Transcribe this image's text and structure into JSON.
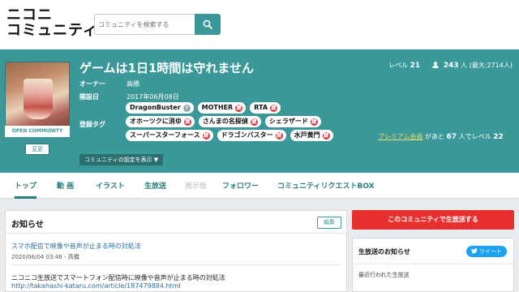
{
  "header": {
    "logo_line1": "ニコニ",
    "logo_line2": "コミュニティ",
    "search_placeholder": "コミュニティを検索する"
  },
  "community": {
    "title": "ゲームは1日1時間は守れません",
    "thumb_label": "OPEN COMMUNITY",
    "change_label": "変更",
    "level_label": "レベル",
    "level": "21",
    "members": "243",
    "members_unit": "人",
    "members_max": "(最大:2714人)",
    "owner_label": "オーナー",
    "owner": "高橋",
    "opened_label": "開設日",
    "opened": "2017年06月08日",
    "tags_label": "登録タグ",
    "tags": [
      {
        "name": "DragonBuster",
        "lock": "?",
        "locked": false
      },
      {
        "name": "MOTHER",
        "lock": "鍵",
        "locked": true
      },
      {
        "name": "RTA",
        "lock": "鍵",
        "locked": true
      },
      {
        "name": "オホーツクに消ゆ",
        "lock": "鍵",
        "locked": true
      },
      {
        "name": "さんまの名探偵",
        "lock": "鍵",
        "locked": true
      },
      {
        "name": "シェラザード",
        "lock": "鍵",
        "locked": true
      },
      {
        "name": "スーパースターフォース",
        "lock": "鍵",
        "locked": true
      },
      {
        "name": "ドラゴンバスター",
        "lock": "鍵",
        "locked": true
      },
      {
        "name": "水戸黄門",
        "lock": "鍵",
        "locked": true
      }
    ],
    "premium_link": "プレミアム会員",
    "premium_text_1": "があと",
    "premium_count": "67",
    "premium_text_2": "人でレベル",
    "premium_level": "22",
    "settings_label": "コミュニティの設定を表示 ▼"
  },
  "tabs": [
    {
      "label": "トップ"
    },
    {
      "label": "動 画"
    },
    {
      "label": "イラスト"
    },
    {
      "label": "生放送"
    },
    {
      "label": "掲示板"
    },
    {
      "label": "フォロワー"
    },
    {
      "label": "コミュニティリクエストBOX"
    }
  ],
  "notice": {
    "title": "お知らせ",
    "edit_label": "編集",
    "item_title": "スマホ配信で映像や音声が止まる時の対処法",
    "item_meta": "2020/06/04 03:46 - 高橋",
    "item_body": "ニコニコ生放送でスマートフォン配信時に映像や音声が止まる時の対処法",
    "item_url": "http://takahashi-kataru.com/article/187479884.html"
  },
  "side": {
    "live_button": "このコミュニティで生放送する",
    "live_notice_title": "生放送のお知らせ",
    "tweet_label": "ツイート",
    "recent_label": "最近行われた生放送"
  },
  "colors": {
    "teal": "#3a9898",
    "red": "#e8312f",
    "twitter": "#1da1f2"
  }
}
